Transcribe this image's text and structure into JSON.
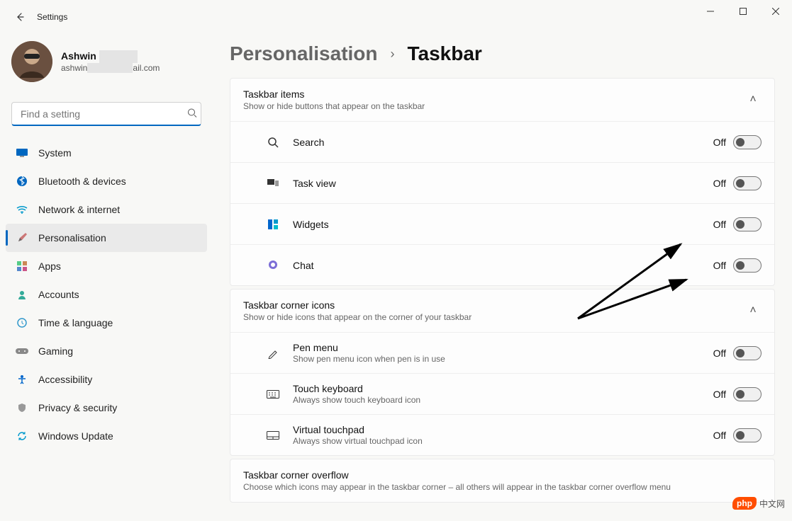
{
  "window": {
    "title": "Settings"
  },
  "user": {
    "name": "Ashwin",
    "email_prefix": "ashwin",
    "email_suffix": "ail.com"
  },
  "search": {
    "placeholder": "Find a setting"
  },
  "nav": [
    {
      "id": "system",
      "label": "System",
      "icon": "💻"
    },
    {
      "id": "bluetooth",
      "label": "Bluetooth & devices",
      "icon": "bt"
    },
    {
      "id": "network",
      "label": "Network & internet",
      "icon": "📶"
    },
    {
      "id": "personalisation",
      "label": "Personalisation",
      "icon": "🖌️",
      "active": true
    },
    {
      "id": "apps",
      "label": "Apps",
      "icon": "▦"
    },
    {
      "id": "accounts",
      "label": "Accounts",
      "icon": "👤"
    },
    {
      "id": "time",
      "label": "Time & language",
      "icon": "🕒"
    },
    {
      "id": "gaming",
      "label": "Gaming",
      "icon": "🎮"
    },
    {
      "id": "accessibility",
      "label": "Accessibility",
      "icon": "🧍"
    },
    {
      "id": "privacy",
      "label": "Privacy & security",
      "icon": "🛡️"
    },
    {
      "id": "update",
      "label": "Windows Update",
      "icon": "🔄"
    }
  ],
  "breadcrumb": {
    "parent": "Personalisation",
    "current": "Taskbar"
  },
  "sections": {
    "items": {
      "title": "Taskbar items",
      "sub": "Show or hide buttons that appear on the taskbar",
      "rows": [
        {
          "id": "search",
          "label": "Search",
          "state": "Off"
        },
        {
          "id": "taskview",
          "label": "Task view",
          "state": "Off"
        },
        {
          "id": "widgets",
          "label": "Widgets",
          "state": "Off"
        },
        {
          "id": "chat",
          "label": "Chat",
          "state": "Off"
        }
      ]
    },
    "corner": {
      "title": "Taskbar corner icons",
      "sub": "Show or hide icons that appear on the corner of your taskbar",
      "rows": [
        {
          "id": "pen",
          "label": "Pen menu",
          "sub": "Show pen menu icon when pen is in use",
          "state": "Off"
        },
        {
          "id": "touchkb",
          "label": "Touch keyboard",
          "sub": "Always show touch keyboard icon",
          "state": "Off"
        },
        {
          "id": "touchpad",
          "label": "Virtual touchpad",
          "sub": "Always show virtual touchpad icon",
          "state": "Off"
        }
      ]
    },
    "overflow": {
      "title": "Taskbar corner overflow",
      "sub": "Choose which icons may appear in the taskbar corner – all others will appear in the taskbar corner overflow menu"
    }
  },
  "watermark": {
    "badge": "php",
    "text": "中文网"
  }
}
